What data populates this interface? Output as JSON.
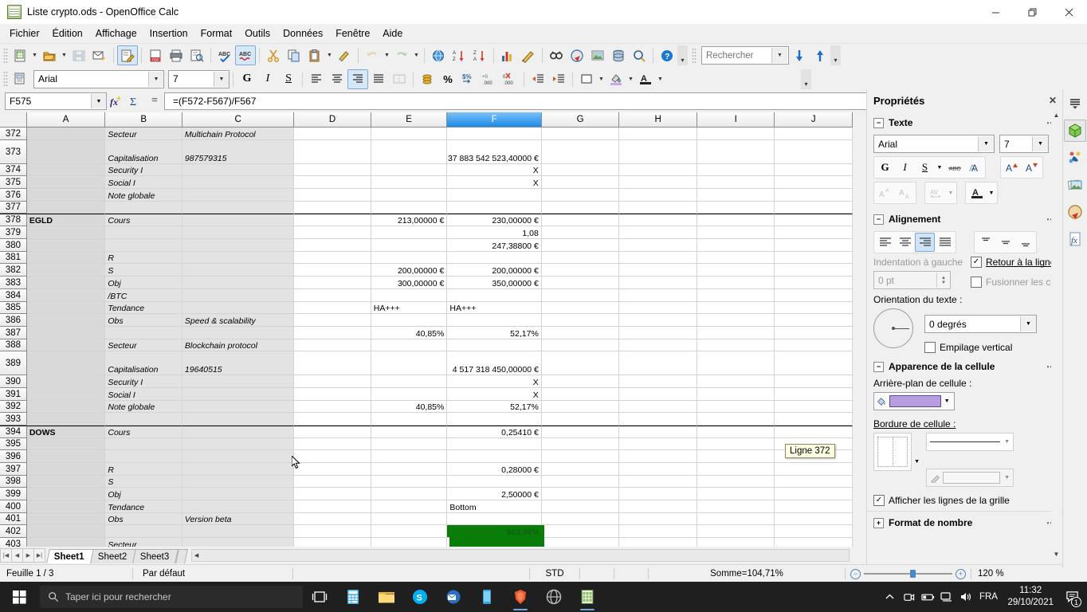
{
  "window": {
    "title": "Liste crypto.ods - OpenOffice Calc",
    "minimize": "—",
    "maximize": "❐",
    "close": "✕"
  },
  "menu": [
    "Fichier",
    "Édition",
    "Affichage",
    "Insertion",
    "Format",
    "Outils",
    "Données",
    "Fenêtre",
    "Aide"
  ],
  "search": {
    "placeholder": "Rechercher"
  },
  "fontbar": {
    "font_name": "Arial",
    "font_size": "7",
    "bold": "G",
    "italic": "I",
    "underline": "S"
  },
  "formulabar": {
    "cell_reference": "F575",
    "formula": "=(F572-F567)/F567",
    "equals": "="
  },
  "grid": {
    "columns": [
      "A",
      "B",
      "C",
      "D",
      "E",
      "F",
      "G",
      "H",
      "I",
      "J"
    ],
    "selected_column": "F",
    "tooltip": "Ligne 372",
    "rows": [
      {
        "n": "372",
        "a": "",
        "b": "Secteur",
        "c": "Multichain Protocol",
        "d": "",
        "e": "",
        "f": "",
        "g": "",
        "h": "",
        "i": "",
        "j": ""
      },
      {
        "n": "373",
        "a": "",
        "b": "Capitalisation",
        "c": "987579315",
        "d": "",
        "e": "",
        "f": "37 883 542 523,40000 €",
        "g": "",
        "h": "",
        "i": "",
        "j": ""
      },
      {
        "n": "374",
        "a": "",
        "b": "Security I",
        "c": "",
        "d": "",
        "e": "",
        "f": "X",
        "g": "",
        "h": "",
        "i": "",
        "j": ""
      },
      {
        "n": "375",
        "a": "",
        "b": "Social I",
        "c": "",
        "d": "",
        "e": "",
        "f": "X",
        "g": "",
        "h": "",
        "i": "",
        "j": ""
      },
      {
        "n": "376",
        "a": "",
        "b": "Note globale",
        "c": "",
        "d": "",
        "e": "",
        "f": "",
        "g": "",
        "h": "",
        "i": "",
        "j": ""
      },
      {
        "n": "377",
        "a": "",
        "b": "",
        "c": "",
        "d": "",
        "e": "",
        "f": "",
        "g": "",
        "h": "",
        "i": "",
        "j": ""
      },
      {
        "n": "378",
        "a": "EGLD",
        "b": "Cours",
        "c": "",
        "d": "",
        "e": "213,00000 €",
        "f": "230,00000 €",
        "g": "",
        "h": "",
        "i": "",
        "j": ""
      },
      {
        "n": "379",
        "a": "",
        "b": "",
        "c": "",
        "d": "",
        "e": "",
        "f": "1,08",
        "g": "",
        "h": "",
        "i": "",
        "j": ""
      },
      {
        "n": "380",
        "a": "",
        "b": "",
        "c": "",
        "d": "",
        "e": "",
        "f": "247,38800 €",
        "g": "",
        "h": "",
        "i": "",
        "j": ""
      },
      {
        "n": "381",
        "a": "",
        "b": "R",
        "c": "",
        "d": "",
        "e": "",
        "f": "",
        "g": "",
        "h": "",
        "i": "",
        "j": ""
      },
      {
        "n": "382",
        "a": "",
        "b": "S",
        "c": "",
        "d": "",
        "e": "200,00000 €",
        "f": "200,00000 €",
        "g": "",
        "h": "",
        "i": "",
        "j": ""
      },
      {
        "n": "383",
        "a": "",
        "b": "Obj",
        "c": "",
        "d": "",
        "e": "300,00000 €",
        "f": "350,00000 €",
        "g": "",
        "h": "",
        "i": "",
        "j": ""
      },
      {
        "n": "384",
        "a": "",
        "b": "/BTC",
        "c": "",
        "d": "",
        "e": "",
        "f": "",
        "g": "",
        "h": "",
        "i": "",
        "j": ""
      },
      {
        "n": "385",
        "a": "",
        "b": "Tendance",
        "c": "",
        "d": "",
        "e": "HA+++",
        "f": "HA+++",
        "g": "",
        "h": "",
        "i": "",
        "j": ""
      },
      {
        "n": "386",
        "a": "",
        "b": "Obs",
        "c": "Speed & scalability",
        "d": "",
        "e": "",
        "f": "",
        "g": "",
        "h": "",
        "i": "",
        "j": ""
      },
      {
        "n": "387",
        "a": "",
        "b": "",
        "c": "",
        "d": "",
        "e": "40,85%",
        "f": "52,17%",
        "g": "",
        "h": "",
        "i": "",
        "j": ""
      },
      {
        "n": "388",
        "a": "",
        "b": "Secteur",
        "c": "Blockchain protocol",
        "d": "",
        "e": "",
        "f": "",
        "g": "",
        "h": "",
        "i": "",
        "j": ""
      },
      {
        "n": "389",
        "a": "",
        "b": "Capitalisation",
        "c": "19640515",
        "d": "",
        "e": "",
        "f": "4 517 318 450,00000 €",
        "g": "",
        "h": "",
        "i": "",
        "j": ""
      },
      {
        "n": "390",
        "a": "",
        "b": "Security I",
        "c": "",
        "d": "",
        "e": "",
        "f": "X",
        "g": "",
        "h": "",
        "i": "",
        "j": ""
      },
      {
        "n": "391",
        "a": "",
        "b": "Social I",
        "c": "",
        "d": "",
        "e": "",
        "f": "X",
        "g": "",
        "h": "",
        "i": "",
        "j": ""
      },
      {
        "n": "392",
        "a": "",
        "b": "Note globale",
        "c": "",
        "d": "",
        "e": "40,85%",
        "f": "52,17%",
        "g": "",
        "h": "",
        "i": "",
        "j": ""
      },
      {
        "n": "393",
        "a": "",
        "b": "",
        "c": "",
        "d": "",
        "e": "",
        "f": "",
        "g": "",
        "h": "",
        "i": "",
        "j": ""
      },
      {
        "n": "394",
        "a": "DOWS",
        "b": "Cours",
        "c": "",
        "d": "",
        "e": "",
        "f": "0,25410 €",
        "g": "",
        "h": "",
        "i": "",
        "j": ""
      },
      {
        "n": "395",
        "a": "",
        "b": "",
        "c": "",
        "d": "",
        "e": "",
        "f": "",
        "g": "",
        "h": "",
        "i": "",
        "j": ""
      },
      {
        "n": "396",
        "a": "",
        "b": "",
        "c": "",
        "d": "",
        "e": "",
        "f": "",
        "g": "",
        "h": "",
        "i": "",
        "j": ""
      },
      {
        "n": "397",
        "a": "",
        "b": "R",
        "c": "",
        "d": "",
        "e": "",
        "f": "0,28000 €",
        "g": "",
        "h": "",
        "i": "",
        "j": ""
      },
      {
        "n": "398",
        "a": "",
        "b": "S",
        "c": "",
        "d": "",
        "e": "",
        "f": "",
        "g": "",
        "h": "",
        "i": "",
        "j": ""
      },
      {
        "n": "399",
        "a": "",
        "b": "Obj",
        "c": "",
        "d": "",
        "e": "",
        "f": "2,50000 €",
        "g": "",
        "h": "",
        "i": "",
        "j": ""
      },
      {
        "n": "400",
        "a": "",
        "b": "Tendance",
        "c": "",
        "d": "",
        "e": "",
        "f": "Bottom",
        "g": "",
        "h": "",
        "i": "",
        "j": ""
      },
      {
        "n": "401",
        "a": "",
        "b": "Obs",
        "c": "Version beta",
        "d": "",
        "e": "",
        "f": "",
        "g": "",
        "h": "",
        "i": "",
        "j": ""
      },
      {
        "n": "402",
        "a": "",
        "b": "",
        "c": "",
        "d": "",
        "e": "",
        "f": "983,86%",
        "g": "",
        "h": "",
        "i": "",
        "j": ""
      },
      {
        "n": "403",
        "a": "",
        "b": "Secteur",
        "c": "",
        "d": "",
        "e": "",
        "f": "",
        "g": "",
        "h": "",
        "i": "",
        "j": ""
      }
    ]
  },
  "sheettabs": {
    "tabs": [
      "Sheet1",
      "Sheet2",
      "Sheet3"
    ],
    "active": "Sheet1"
  },
  "statusbar": {
    "sheet_info": "Feuille 1 / 3",
    "page_style": "Par défaut",
    "selection_mode": "STD",
    "sum": "Somme=104,71%",
    "zoom": "120 %"
  },
  "sidebar": {
    "title": "Propriétés",
    "close": "✕",
    "text_panel": {
      "heading": "Texte",
      "font_name": "Arial",
      "font_size": "7",
      "bold": "G",
      "italic": "I",
      "underline": "S"
    },
    "alignment_panel": {
      "heading": "Alignement",
      "indent_label": "Indentation à gauche",
      "indent_value": "0 pt",
      "wrap_label": "Retour à la ligne",
      "merge_label": "Fusionner les ce",
      "orientation_label": "Orientation du texte :",
      "orientation_value": "0 degrés",
      "vertical_label": "Empilage vertical"
    },
    "cell_panel": {
      "heading": "Apparence de la cellule",
      "background_label": "Arrière-plan de cellule :",
      "background_color": "#b69ce0",
      "border_label": "Bordure de cellule :",
      "gridlines_label": "Afficher les lignes de la grille"
    },
    "number_panel": {
      "heading": "Format de nombre"
    }
  },
  "taskbar": {
    "search_placeholder": "Taper ici pour rechercher",
    "language": "FRA",
    "time": "11:32",
    "date": "29/10/2021",
    "notification_count": "1"
  }
}
